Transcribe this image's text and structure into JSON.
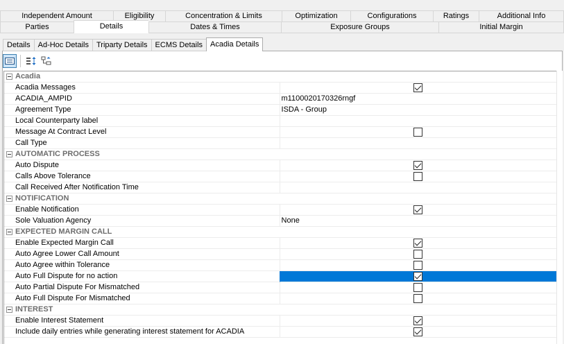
{
  "top_tabs_row1": [
    {
      "label": "Independent Amount",
      "w": 163
    },
    {
      "label": "Eligibility",
      "w": 75
    },
    {
      "label": "Concentration & Limits",
      "w": 168
    },
    {
      "label": "Optimization",
      "w": 99
    },
    {
      "label": "Configurations",
      "w": 119
    },
    {
      "label": "Ratings",
      "w": 66
    },
    {
      "label": "Additional Info",
      "w": 123
    }
  ],
  "top_tabs_row2": [
    {
      "label": "Parties",
      "w": 106,
      "active": false
    },
    {
      "label": "Details",
      "w": 108,
      "active": true
    },
    {
      "label": "Dates & Times",
      "w": 191,
      "active": false
    },
    {
      "label": "Exposure Groups",
      "w": 227,
      "active": false
    },
    {
      "label": "Initial Margin",
      "w": 181,
      "active": false
    }
  ],
  "sub_tabs": [
    {
      "label": "Details",
      "active": false
    },
    {
      "label": "Ad-Hoc Details",
      "active": false
    },
    {
      "label": "Triparty Details",
      "active": false
    },
    {
      "label": "ECMS Details",
      "active": false
    },
    {
      "label": "Acadia Details",
      "active": true
    }
  ],
  "toolbar": {
    "categorized_icon": "categorized-view-icon",
    "sort_icon": "sort-alphabetical-icon",
    "tree_icon": "expand-tree-icon"
  },
  "property_grid": [
    {
      "type": "category",
      "label": "Acadia"
    },
    {
      "type": "prop",
      "label": "Acadia Messages",
      "kind": "check",
      "checked": true
    },
    {
      "type": "prop",
      "label": "ACADIA_AMPID",
      "kind": "text",
      "value": "m1100020170326rngf"
    },
    {
      "type": "prop",
      "label": "Agreement Type",
      "kind": "text",
      "value": "ISDA - Group"
    },
    {
      "type": "prop",
      "label": "Local Counterparty label",
      "kind": "text",
      "value": ""
    },
    {
      "type": "prop",
      "label": "Message At Contract Level",
      "kind": "check",
      "checked": false
    },
    {
      "type": "prop",
      "label": "Call Type",
      "kind": "text",
      "value": ""
    },
    {
      "type": "category",
      "label": "AUTOMATIC PROCESS"
    },
    {
      "type": "prop",
      "label": "Auto Dispute",
      "kind": "check",
      "checked": true
    },
    {
      "type": "prop",
      "label": "Calls Above Tolerance",
      "kind": "check",
      "checked": false
    },
    {
      "type": "prop",
      "label": "Call Received After Notification Time",
      "kind": "text",
      "value": ""
    },
    {
      "type": "category",
      "label": "NOTIFICATION"
    },
    {
      "type": "prop",
      "label": "Enable Notification",
      "kind": "check",
      "checked": true
    },
    {
      "type": "prop",
      "label": "Sole Valuation Agency",
      "kind": "text",
      "value": "None"
    },
    {
      "type": "category",
      "label": "EXPECTED MARGIN CALL"
    },
    {
      "type": "prop",
      "label": "Enable Expected Margin Call",
      "kind": "check",
      "checked": true
    },
    {
      "type": "prop",
      "label": "Auto Agree Lower Call Amount",
      "kind": "check",
      "checked": false
    },
    {
      "type": "prop",
      "label": "Auto Agree within Tolerance",
      "kind": "check",
      "checked": false
    },
    {
      "type": "prop",
      "label": "Auto Full Dispute for no action",
      "kind": "check",
      "checked": true,
      "selected": true
    },
    {
      "type": "prop",
      "label": "Auto Partial Dispute For Mismatched",
      "kind": "check",
      "checked": false
    },
    {
      "type": "prop",
      "label": "Auto Full Dispute For Mismatched",
      "kind": "check",
      "checked": false
    },
    {
      "type": "category",
      "label": "INTEREST"
    },
    {
      "type": "prop",
      "label": "Enable Interest Statement",
      "kind": "check",
      "checked": true
    },
    {
      "type": "prop",
      "label": "Include daily entries while generating interest statement for ACADIA",
      "kind": "check",
      "checked": true
    }
  ],
  "colors": {
    "selection": "#0078d7",
    "category_text": "#6d6d6d",
    "pressed_button": "#cce4f7"
  }
}
